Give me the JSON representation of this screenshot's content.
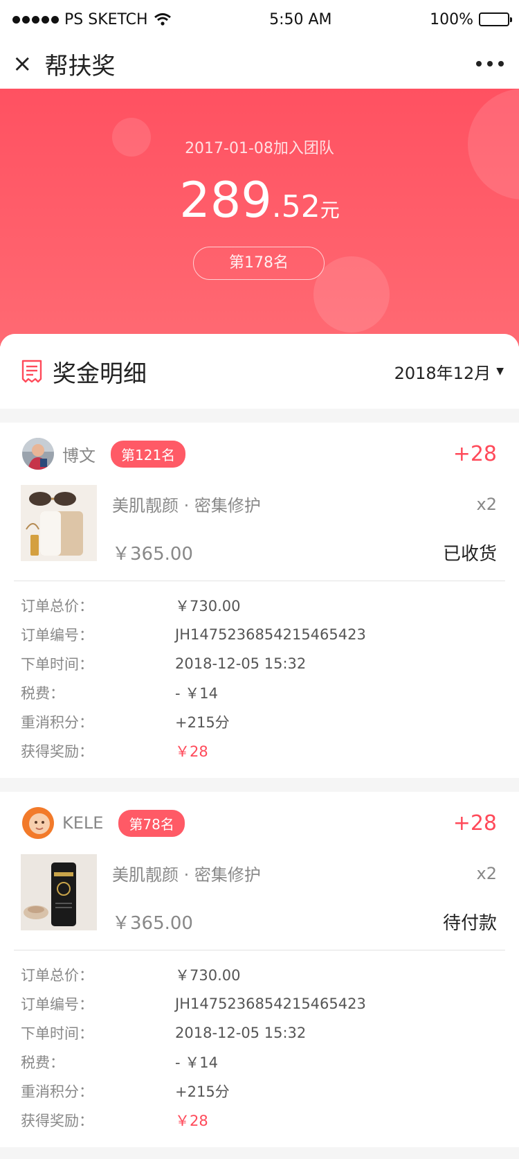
{
  "status_bar": {
    "carrier": "PS SKETCH",
    "time": "5:50 AM",
    "battery": "100%"
  },
  "navbar": {
    "close_icon": "×",
    "title": "帮扶奖"
  },
  "hero": {
    "join_text": "2017-01-08加入团队",
    "amount_int": "289",
    "amount_dec": ".52",
    "amount_unit": "元",
    "rank": "第178名"
  },
  "section": {
    "title": "奖金明细",
    "month": "2018年12月",
    "month_caret": "▼"
  },
  "labels": {
    "total": "订单总价：",
    "order_no": "订单编号：",
    "order_time": "下单时间：",
    "tax": "税费：",
    "points": "重消积分：",
    "reward": "获得奖励："
  },
  "orders": [
    {
      "user": "博文",
      "rank": "第121名",
      "bonus": "+28",
      "product_name": "美肌靓颜 · 密集修护",
      "qty": "x2",
      "price": "￥365.00",
      "status": "已收货",
      "total": "￥730.00",
      "order_no": "JH1475236854215465423",
      "order_time": "2018-12-05 15:32",
      "tax": "- ￥14",
      "points": "+215分",
      "reward": "￥28"
    },
    {
      "user": "KELE",
      "rank": "第78名",
      "bonus": "+28",
      "product_name": "美肌靓颜 · 密集修护",
      "qty": "x2",
      "price": "￥365.00",
      "status": "待付款",
      "total": "￥730.00",
      "order_no": "JH1475236854215465423",
      "order_time": "2018-12-05 15:32",
      "tax": "- ￥14",
      "points": "+215分",
      "reward": "￥28"
    }
  ],
  "colors": {
    "accent": "#ff4a5a",
    "hero_top": "#ff5161",
    "hero_bottom": "#ff6a73"
  }
}
